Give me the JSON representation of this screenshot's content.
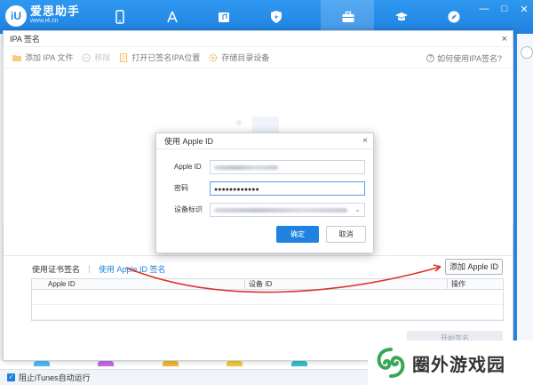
{
  "app": {
    "logo_mark": "iU",
    "logo_name": "爱思助手",
    "logo_url": "www.i4.cn"
  },
  "nav": [
    {
      "name": "my-device",
      "icon": "phone-icon"
    },
    {
      "name": "apps",
      "icon": "app-store-icon"
    },
    {
      "name": "ringtones",
      "icon": "music-icon"
    },
    {
      "name": "flash",
      "icon": "shield-icon"
    },
    {
      "name": "toolbox",
      "icon": "briefcase-icon",
      "active": true
    },
    {
      "name": "tutorials",
      "icon": "graduation-cap-icon"
    },
    {
      "name": "browser",
      "icon": "compass-icon"
    }
  ],
  "window_controls": {
    "minimize": "—",
    "maximize": "□",
    "close": "✕"
  },
  "background": {
    "side_label": "i4",
    "status_text": "阻止iTunes自动运行"
  },
  "ipa_dialog": {
    "title": "IPA 签名",
    "close": "×",
    "toolbar": {
      "add_ipa": "添加 IPA 文件",
      "remove": "移除",
      "open_signed": "打开已签名IPA位置",
      "save_to_device": "存储目录设备",
      "help": "如何使用IPA签名?"
    },
    "tabs": {
      "cert_sign": "使用证书签名",
      "appleid_sign": "使用 Apple ID 签名"
    },
    "add_apple_id_button": "添加 Apple ID",
    "table": {
      "headers": [
        "Apple ID",
        "设备 ID",
        "操作"
      ],
      "rows": []
    },
    "start_sign_button": "开始签名"
  },
  "apple_id_dialog": {
    "title": "使用 Apple ID",
    "close": "×",
    "apple_id_label": "Apple ID",
    "password_label": "密码",
    "password_value": "●●●●●●●●●●●●",
    "device_label": "设备标识",
    "ok_button": "确定",
    "cancel_button": "取消"
  },
  "watermark": {
    "text": "圈外游戏园"
  },
  "colors": {
    "accent": "#1f82e0",
    "arrow": "#d9342b",
    "watermark_green": "#3aa655"
  }
}
